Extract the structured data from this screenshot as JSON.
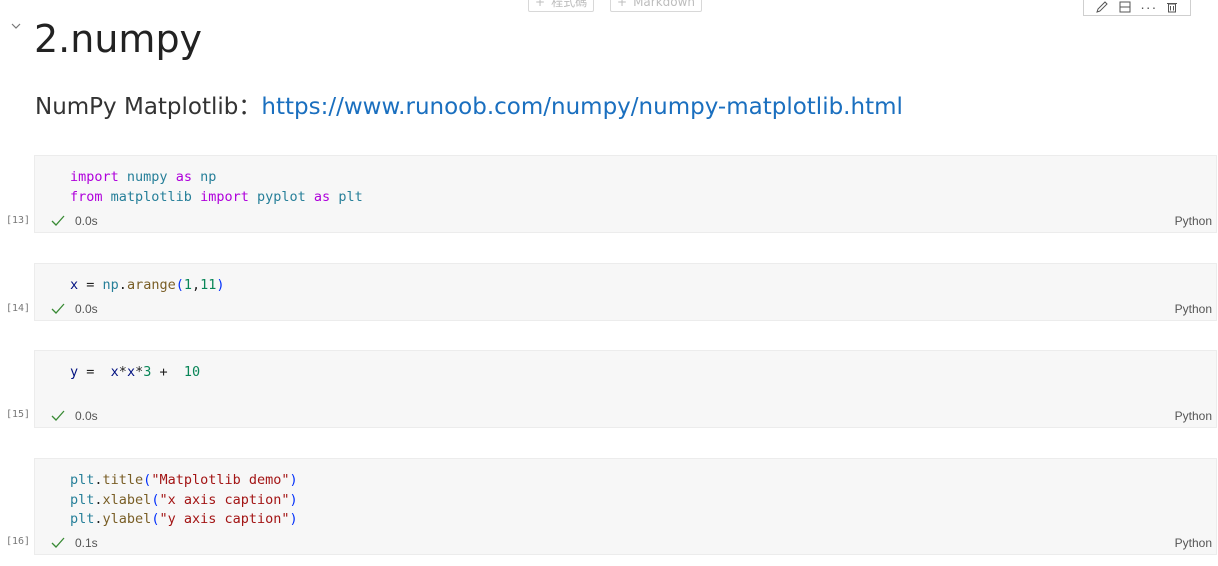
{
  "toolbar": {
    "add_code_label": "程式碼",
    "add_markdown_label": "Markdown",
    "plus_glyph": "+",
    "more_glyph": "···"
  },
  "markdown": {
    "heading": "2.numpy",
    "para_prefix": "NumPy Matplotlib：",
    "link_text": "https://www.runoob.com/numpy/numpy-matplotlib.html"
  },
  "cells": [
    {
      "exec_count": "[13]",
      "lines": [
        "import numpy as np",
        "from matplotlib import pyplot as plt"
      ],
      "status_time": "0.0s",
      "language": "Python"
    },
    {
      "exec_count": "[14]",
      "lines": [
        "x = np.arange(1,11)"
      ],
      "status_time": "0.0s",
      "language": "Python"
    },
    {
      "exec_count": "[15]",
      "lines": [
        "y =  x*x*3 +  10"
      ],
      "status_time": "0.0s",
      "language": "Python"
    },
    {
      "exec_count": "[16]",
      "lines": [
        "plt.title(\"Matplotlib demo\")",
        "plt.xlabel(\"x axis caption\")",
        "plt.ylabel(\"y axis caption\")"
      ],
      "status_time": "0.1s",
      "language": "Python"
    }
  ],
  "icons": {
    "edit": "pencil-icon",
    "split": "split-cell-icon",
    "more": "more-icon",
    "delete": "trash-icon",
    "collapse": "chevron-down-icon",
    "success": "check-icon"
  },
  "colors": {
    "link": "#1a6fbf",
    "keyword": "#af00db",
    "module": "#267f99",
    "function": "#795e26",
    "number": "#098658",
    "string": "#a31515",
    "success": "#388a34",
    "cell_bg": "#f7f7f7"
  }
}
